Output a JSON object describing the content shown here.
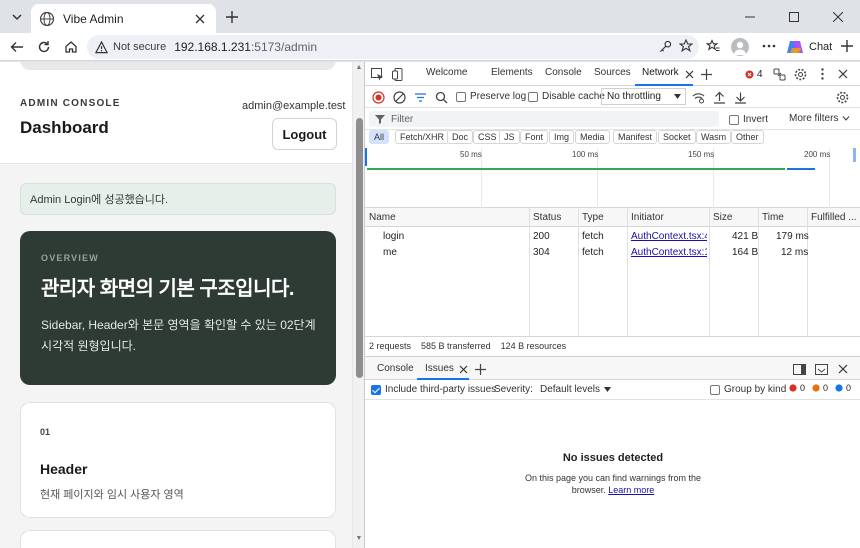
{
  "browser": {
    "tab_title": "Vibe Admin",
    "not_secure": "Not secure",
    "url_host": "192.168.1.231",
    "url_path": ":5173/admin",
    "chat_label": "Chat"
  },
  "page": {
    "console_label": "ADMIN CONSOLE",
    "title": "Dashboard",
    "user_email": "admin@example.test",
    "logout_label": "Logout",
    "alert": "Admin Login에 성공했습니다.",
    "overview": {
      "kicker": "OVERVIEW",
      "headline": "관리자 화면의 기본 구조입니다.",
      "desc": "Sidebar, Header와 본문 영역을 확인할 수 있는 02단계 시각적 원형입니다."
    },
    "card": {
      "num": "01",
      "title": "Header",
      "desc": "현재 페이지와 임시 사용자 영역"
    }
  },
  "devtools": {
    "tabs": [
      "Welcome",
      "Elements",
      "Console",
      "Sources",
      "Network"
    ],
    "error_count": "4",
    "preserve_log": "Preserve log",
    "disable_cache": "Disable cache",
    "throttling": "No throttling",
    "filter_placeholder": "Filter",
    "invert": "Invert",
    "more_filters": "More filters",
    "types": [
      "All",
      "Fetch/XHR",
      "Doc",
      "CSS",
      "JS",
      "Font",
      "Img",
      "Media",
      "Manifest",
      "Socket",
      "Wasm",
      "Other"
    ],
    "timeline_ticks": [
      "50 ms",
      "100 ms",
      "150 ms",
      "200 ms"
    ],
    "columns": [
      "Name",
      "Status",
      "Type",
      "Initiator",
      "Size",
      "Time",
      "Fulfilled ..."
    ],
    "requests": [
      {
        "name": "login",
        "status": "200",
        "type": "fetch",
        "initiator": "AuthContext.tsx:43",
        "size": "421 B",
        "time": "179 ms"
      },
      {
        "name": "me",
        "status": "304",
        "type": "fetch",
        "initiator": "AuthContext.tsx:10",
        "size": "164 B",
        "time": "12 ms"
      }
    ],
    "summary": {
      "requests": "2 requests",
      "transferred": "585 B transferred",
      "resources": "124 B resources"
    },
    "drawer_tabs": [
      "Console",
      "Issues"
    ],
    "include_third_party": "Include third-party issues",
    "severity_label": "Severity:",
    "severity_value": "Default levels",
    "group_by_kind": "Group by kind",
    "issue_counts": [
      "0",
      "0",
      "0"
    ],
    "no_issues_title": "No issues detected",
    "no_issues_text": "On this page you can find warnings from the browser.",
    "learn_more": "Learn more"
  }
}
